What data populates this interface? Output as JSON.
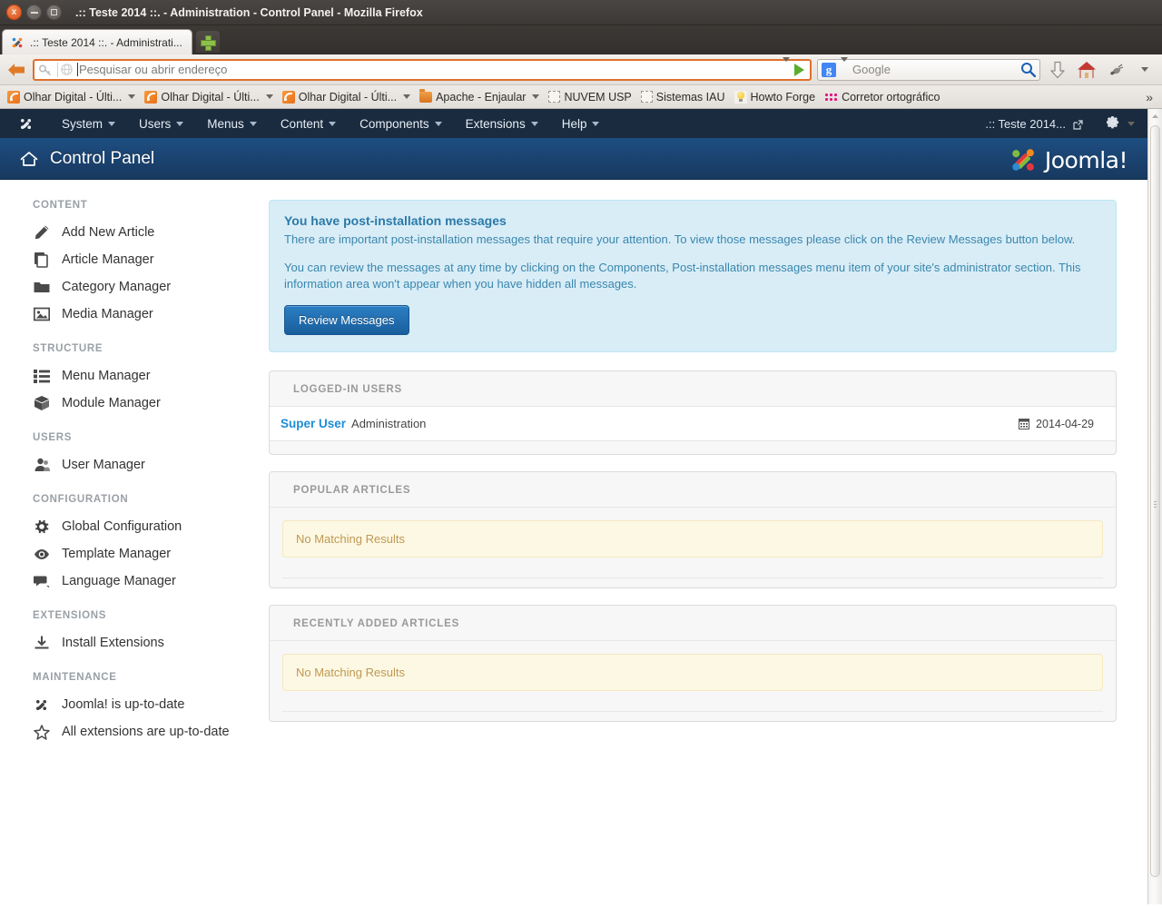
{
  "window": {
    "title": ".:: Teste 2014 ::. - Administration - Control Panel - Mozilla Firefox",
    "close_label": "x"
  },
  "browser": {
    "tab": {
      "label": ".:: Teste 2014 ::. - Administrati...",
      "favicon": "joomla-icon"
    },
    "new_tab_label": "+",
    "url_placeholder": "Pesquisar ou abrir endereço",
    "url_value": "",
    "search_engine": "Google",
    "search_engine_badge": "g",
    "bookmarks": [
      {
        "label": "Olhar Digital - Últi...",
        "icon": "rss-icon",
        "has_caret": true
      },
      {
        "label": "Olhar Digital - Últi...",
        "icon": "rss-icon",
        "has_caret": true
      },
      {
        "label": "Olhar Digital - Últi...",
        "icon": "rss-icon",
        "has_caret": true
      },
      {
        "label": "Apache - Enjaular",
        "icon": "folder-icon",
        "has_caret": true
      },
      {
        "label": "NUVEM USP",
        "icon": "blank-page-icon",
        "has_caret": false
      },
      {
        "label": "Sistemas IAU",
        "icon": "blank-page-icon",
        "has_caret": false
      },
      {
        "label": "Howto Forge",
        "icon": "lightbulb-icon",
        "has_caret": false
      },
      {
        "label": "Corretor ortográfico",
        "icon": "dots-icon",
        "has_caret": false
      }
    ],
    "overflow_label": "»",
    "toolbar_icons": [
      "download-arrow-icon",
      "home-icon",
      "bug-icon",
      "chevron-down-icon"
    ]
  },
  "admin": {
    "menu": [
      {
        "label": "System",
        "caret": true
      },
      {
        "label": "Users",
        "caret": true
      },
      {
        "label": "Menus",
        "caret": true
      },
      {
        "label": "Content",
        "caret": true
      },
      {
        "label": "Components",
        "caret": true
      },
      {
        "label": "Extensions",
        "caret": true
      },
      {
        "label": "Help",
        "caret": true
      }
    ],
    "site_name": ".:: Teste 2014...",
    "page_title": "Control Panel",
    "brand": "Joomla!"
  },
  "sidebar": [
    {
      "heading": "CONTENT",
      "items": [
        {
          "label": "Add New Article",
          "icon": "pencil-icon"
        },
        {
          "label": "Article Manager",
          "icon": "copy-icon"
        },
        {
          "label": "Category Manager",
          "icon": "folder-icon"
        },
        {
          "label": "Media Manager",
          "icon": "picture-icon"
        }
      ]
    },
    {
      "heading": "STRUCTURE",
      "items": [
        {
          "label": "Menu Manager",
          "icon": "list-icon"
        },
        {
          "label": "Module Manager",
          "icon": "cube-icon"
        }
      ]
    },
    {
      "heading": "USERS",
      "items": [
        {
          "label": "User Manager",
          "icon": "user-icon"
        }
      ]
    },
    {
      "heading": "CONFIGURATION",
      "items": [
        {
          "label": "Global Configuration",
          "icon": "gear-icon"
        },
        {
          "label": "Template Manager",
          "icon": "eye-icon"
        },
        {
          "label": "Language Manager",
          "icon": "comment-icon"
        }
      ]
    },
    {
      "heading": "EXTENSIONS",
      "items": [
        {
          "label": "Install Extensions",
          "icon": "download-icon"
        }
      ]
    },
    {
      "heading": "MAINTENANCE",
      "items": [
        {
          "label": "Joomla! is up-to-date",
          "icon": "joomla-icon"
        },
        {
          "label": "All extensions are up-to-date",
          "icon": "star-icon"
        }
      ]
    }
  ],
  "alert": {
    "title": "You have post-installation messages",
    "p1": "There are important post-installation messages that require your attention. To view those messages please click on the Review Messages button below.",
    "p2": "You can review the messages at any time by clicking on the Components, Post-installation messages menu item of your site's administrator section. This information area won't appear when you have hidden all messages.",
    "button": "Review Messages"
  },
  "panels": {
    "logged_in": {
      "title": "LOGGED-IN USERS",
      "rows": [
        {
          "user": "Super User",
          "group": "Administration",
          "date": "2014-04-29",
          "date_icon": "calendar-icon"
        }
      ]
    },
    "popular": {
      "title": "POPULAR ARTICLES",
      "empty": "No Matching Results"
    },
    "recent": {
      "title": "RECENTLY ADDED ARTICLES",
      "empty": "No Matching Results"
    }
  },
  "colors": {
    "admin_menu_bg": "#1a2b3f",
    "admin_subhead_bg": "#1b4472",
    "alert_bg": "#d9edf7",
    "alert_text": "#3a87ad",
    "warning_bg": "#fcf8e3",
    "warning_text": "#c09853",
    "link_blue": "#1c8dd6",
    "accent_orange": "#e06f2c"
  }
}
